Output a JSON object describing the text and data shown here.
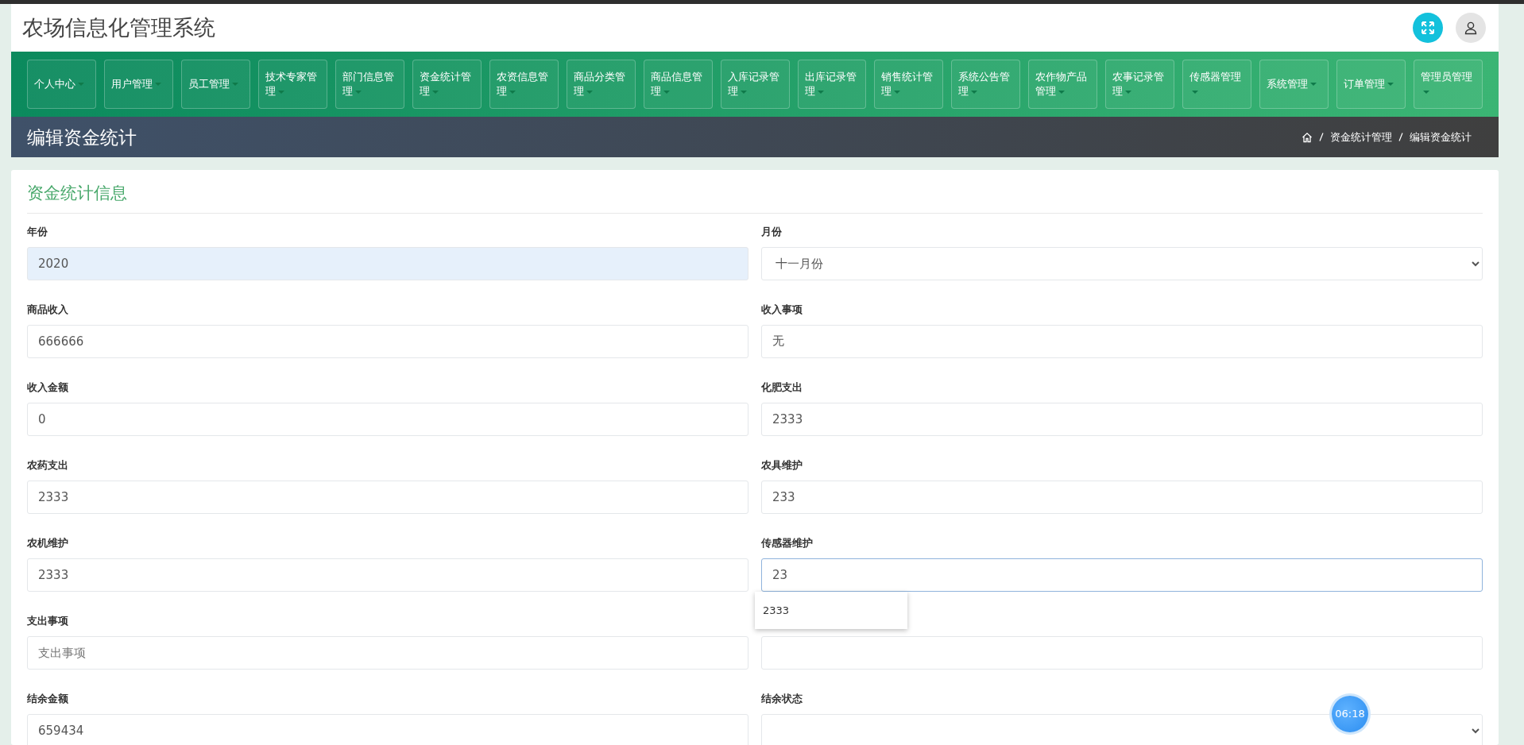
{
  "header": {
    "title": "农场信息化管理系统"
  },
  "nav": [
    {
      "label": "个人中心"
    },
    {
      "label": "用户管理"
    },
    {
      "label": "员工管理"
    },
    {
      "label": "技术专家管理"
    },
    {
      "label": "部门信息管理"
    },
    {
      "label": "资金统计管理"
    },
    {
      "label": "农资信息管理"
    },
    {
      "label": "商品分类管理"
    },
    {
      "label": "商品信息管理"
    },
    {
      "label": "入库记录管理"
    },
    {
      "label": "出库记录管理"
    },
    {
      "label": "销售统计管理"
    },
    {
      "label": "系统公告管理"
    },
    {
      "label": "农作物产品管理"
    },
    {
      "label": "农事记录管理"
    },
    {
      "label": "传感器管理"
    },
    {
      "label": "系统管理"
    },
    {
      "label": "订单管理"
    },
    {
      "label": "管理员管理"
    }
  ],
  "page_title": "编辑资金统计",
  "breadcrumb": [
    "资金统计管理",
    "编辑资金统计"
  ],
  "form": {
    "title": "资金统计信息",
    "fields": [
      {
        "label": "年份",
        "kind": "input",
        "value": "2020",
        "autofilled": true,
        "focused": false
      },
      {
        "label": "月份",
        "kind": "select",
        "value": "十一月份",
        "autofilled": false,
        "focused": false
      },
      {
        "label": "商品收入",
        "kind": "input",
        "value": "666666",
        "autofilled": false,
        "focused": false
      },
      {
        "label": "收入事项",
        "kind": "input",
        "value": "无",
        "autofilled": false,
        "focused": false
      },
      {
        "label": "收入金额",
        "kind": "input",
        "value": "0",
        "autofilled": false,
        "focused": false
      },
      {
        "label": "化肥支出",
        "kind": "input",
        "value": "2333",
        "autofilled": false,
        "focused": false
      },
      {
        "label": "农药支出",
        "kind": "input",
        "value": "2333",
        "autofilled": false,
        "focused": false
      },
      {
        "label": "农具维护",
        "kind": "input",
        "value": "233",
        "autofilled": false,
        "focused": false
      },
      {
        "label": "农机维护",
        "kind": "input",
        "value": "2333",
        "autofilled": false,
        "focused": false
      },
      {
        "label": "传感器维护",
        "kind": "input",
        "value": "23",
        "autofilled": false,
        "focused": true,
        "suggestions": [
          "2333"
        ]
      },
      {
        "label": "支出事项",
        "kind": "input",
        "placeholder": "支出事项",
        "autofilled": false,
        "focused": false
      },
      {
        "kind": "input",
        "autofilled": false,
        "focused": false
      },
      {
        "label": "结余金额",
        "kind": "input",
        "value": "659434",
        "autofilled": false,
        "focused": false
      },
      {
        "label": "结余状态",
        "kind": "select",
        "autofilled": false,
        "focused": false
      }
    ]
  },
  "timer": "06:18"
}
